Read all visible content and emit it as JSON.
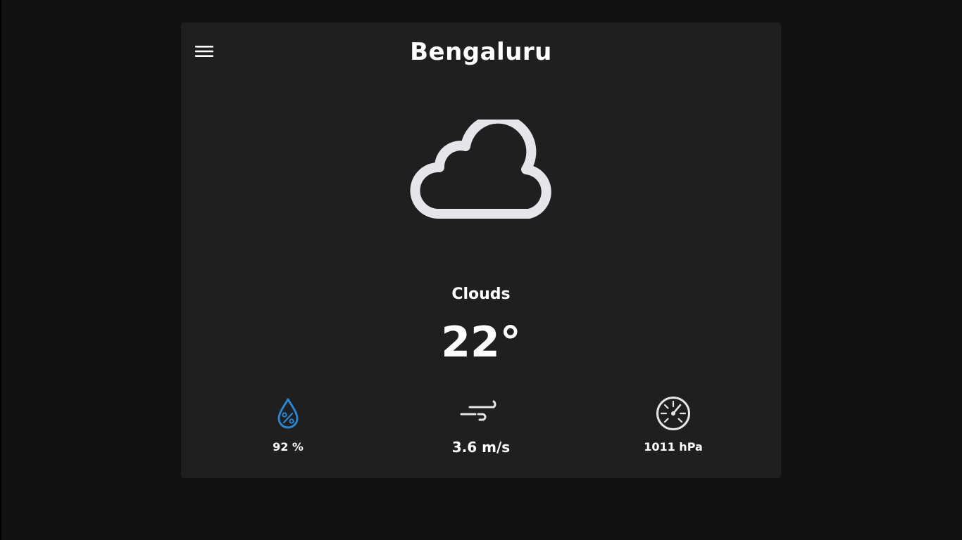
{
  "city": "Bengaluru",
  "condition": "Clouds",
  "temperature": "22°",
  "stats": {
    "humidity": "92 %",
    "wind": "3.6 m/s",
    "pressure": "1011 hPa"
  },
  "icons": {
    "menu": "hamburger-menu-icon",
    "weather": "cloud-icon",
    "humidity": "humidity-drop-icon",
    "wind": "wind-icon",
    "pressure": "barometer-icon"
  },
  "colors": {
    "background": "#121212",
    "card": "#1f1f1f",
    "text": "#ffffff",
    "cloud": "#e6e6ea",
    "humidity_accent": "#2a86d1"
  }
}
